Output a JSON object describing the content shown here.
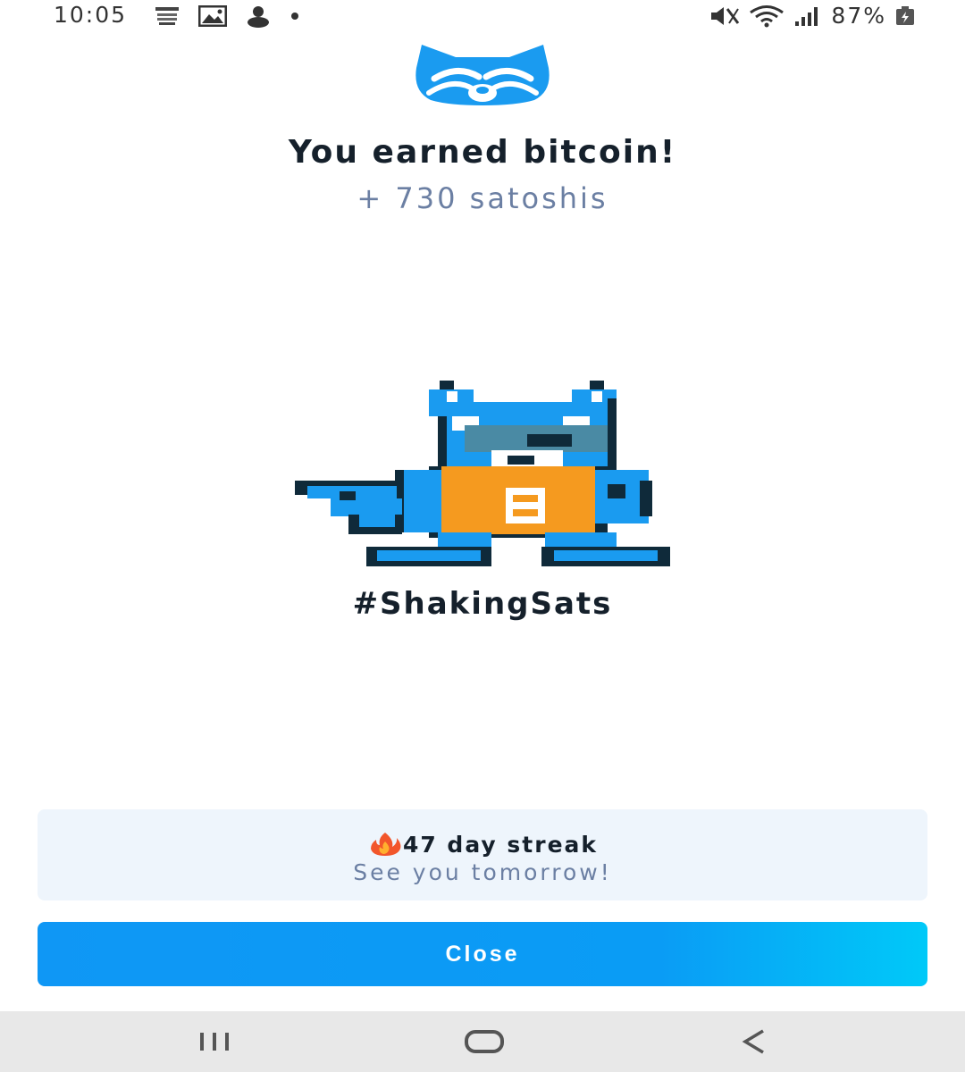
{
  "status_bar": {
    "time": "10:05",
    "battery": "87%",
    "left_icons": [
      "state-news-icon",
      "gallery-icon",
      "person-icon",
      "dot-icon"
    ],
    "right_icons": [
      "mute-icon",
      "wifi-icon",
      "signal-icon",
      "battery-icon"
    ]
  },
  "reward": {
    "title": "You earned bitcoin!",
    "amount": "+ 730 satoshis"
  },
  "hashtag": "#ShakingSats",
  "streak": {
    "label": "47 day streak",
    "message": "See you tomorrow!"
  },
  "actions": {
    "close_label": "Close"
  },
  "colors": {
    "accent": "#0f97f5",
    "mascot_blue": "#1a9bf0",
    "mascot_orange": "#f59a1f",
    "text_dark": "#15202b",
    "text_muted": "#6b7fa3",
    "card_bg": "#eef5fc"
  },
  "nav": {
    "items": [
      "recents-icon",
      "home-icon",
      "back-icon"
    ]
  }
}
